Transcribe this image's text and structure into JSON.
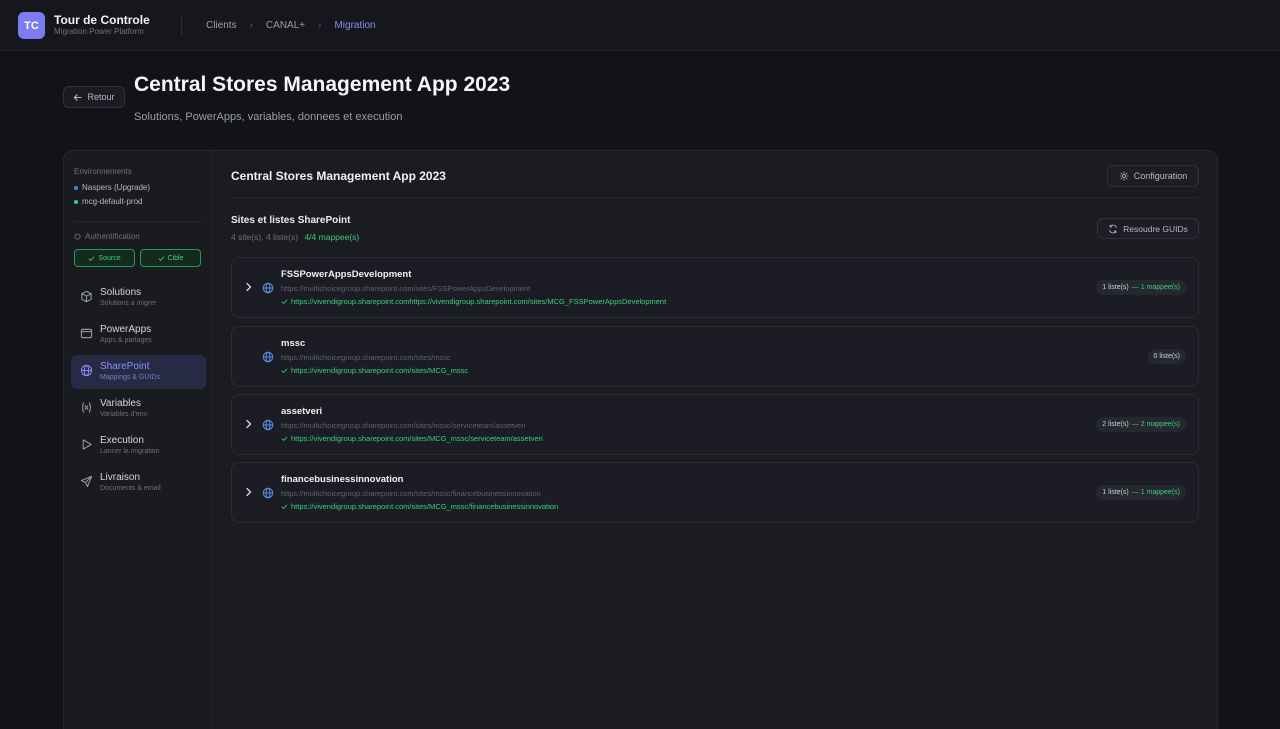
{
  "brand": {
    "initials": "TC",
    "title": "Tour de Controle",
    "subtitle": "Migration Power Platform"
  },
  "breadcrumb": [
    "Clients",
    "CANAL+",
    "Migration"
  ],
  "header": {
    "back_label": "Retour",
    "title": "Central Stores Management App 2023",
    "subtitle": "Solutions, PowerApps, variables, donnees et execution"
  },
  "sidebar": {
    "env_label": "Environnements",
    "environments": [
      {
        "name": "Naspers (Upgrade)",
        "color": "#4f7df3"
      },
      {
        "name": "mcg-default-prod",
        "color": "#3ccf7a"
      }
    ],
    "auth_label": "Authentification",
    "auth_source": "Source",
    "auth_target": "Cible",
    "items": [
      {
        "title": "Solutions",
        "sub": "Solutions a migrer",
        "icon": "box-icon"
      },
      {
        "title": "PowerApps",
        "sub": "Apps & partages",
        "icon": "window-icon"
      },
      {
        "title": "SharePoint",
        "sub": "Mappings & GUIDs",
        "icon": "globe-icon"
      },
      {
        "title": "Variables",
        "sub": "Variables d'env.",
        "icon": "variable-icon"
      },
      {
        "title": "Execution",
        "sub": "Lancer la migration",
        "icon": "play-icon"
      },
      {
        "title": "Livraison",
        "sub": "Documents & email",
        "icon": "send-icon"
      }
    ]
  },
  "main": {
    "title": "Central Stores Management App 2023",
    "config_label": "Configuration",
    "section_title": "Sites et listes SharePoint",
    "section_stats": "4 site(s), 4 liste(s)",
    "section_mapped": "4/4 mappee(s)",
    "resolve_label": "Resoudre GUIDs",
    "sites": [
      {
        "name": "FSSPowerAppsDevelopment",
        "source": "https://multichoicegroup.sharepoint.com/sites/FSSPowerAppsDevelopment",
        "target": "https://vivendigroup.sharepoint.comhttps://vivendigroup.sharepoint.com/sites/MCG_FSSPowerAppsDevelopment",
        "lists": "1 liste(s)",
        "mapped": "— 1 mappee(s)",
        "expandable": true
      },
      {
        "name": "mssc",
        "source": "https://multichoicegroup.sharepoint.com/sites/mssc",
        "target": "https://vivendigroup.sharepoint.com/sites/MCG_mssc",
        "lists": "0 liste(s)",
        "mapped": "",
        "expandable": false
      },
      {
        "name": "assetveri",
        "source": "https://multichoicegroup.sharepoint.com/sites/mssc/serviceteam/assetveri",
        "target": "https://vivendigroup.sharepoint.com/sites/MCG_mssc/serviceteam/assetveri",
        "lists": "2 liste(s)",
        "mapped": "— 2 mappee(s)",
        "expandable": true
      },
      {
        "name": "financebusinessinnovation",
        "source": "https://multichoicegroup.sharepoint.com/sites/mssc/financebusinessinnovation",
        "target": "https://vivendigroup.sharepoint.com/sites/MCG_mssc/financebusinessinnovation",
        "lists": "1 liste(s)",
        "mapped": "— 1 mappee(s)",
        "expandable": true
      }
    ]
  }
}
